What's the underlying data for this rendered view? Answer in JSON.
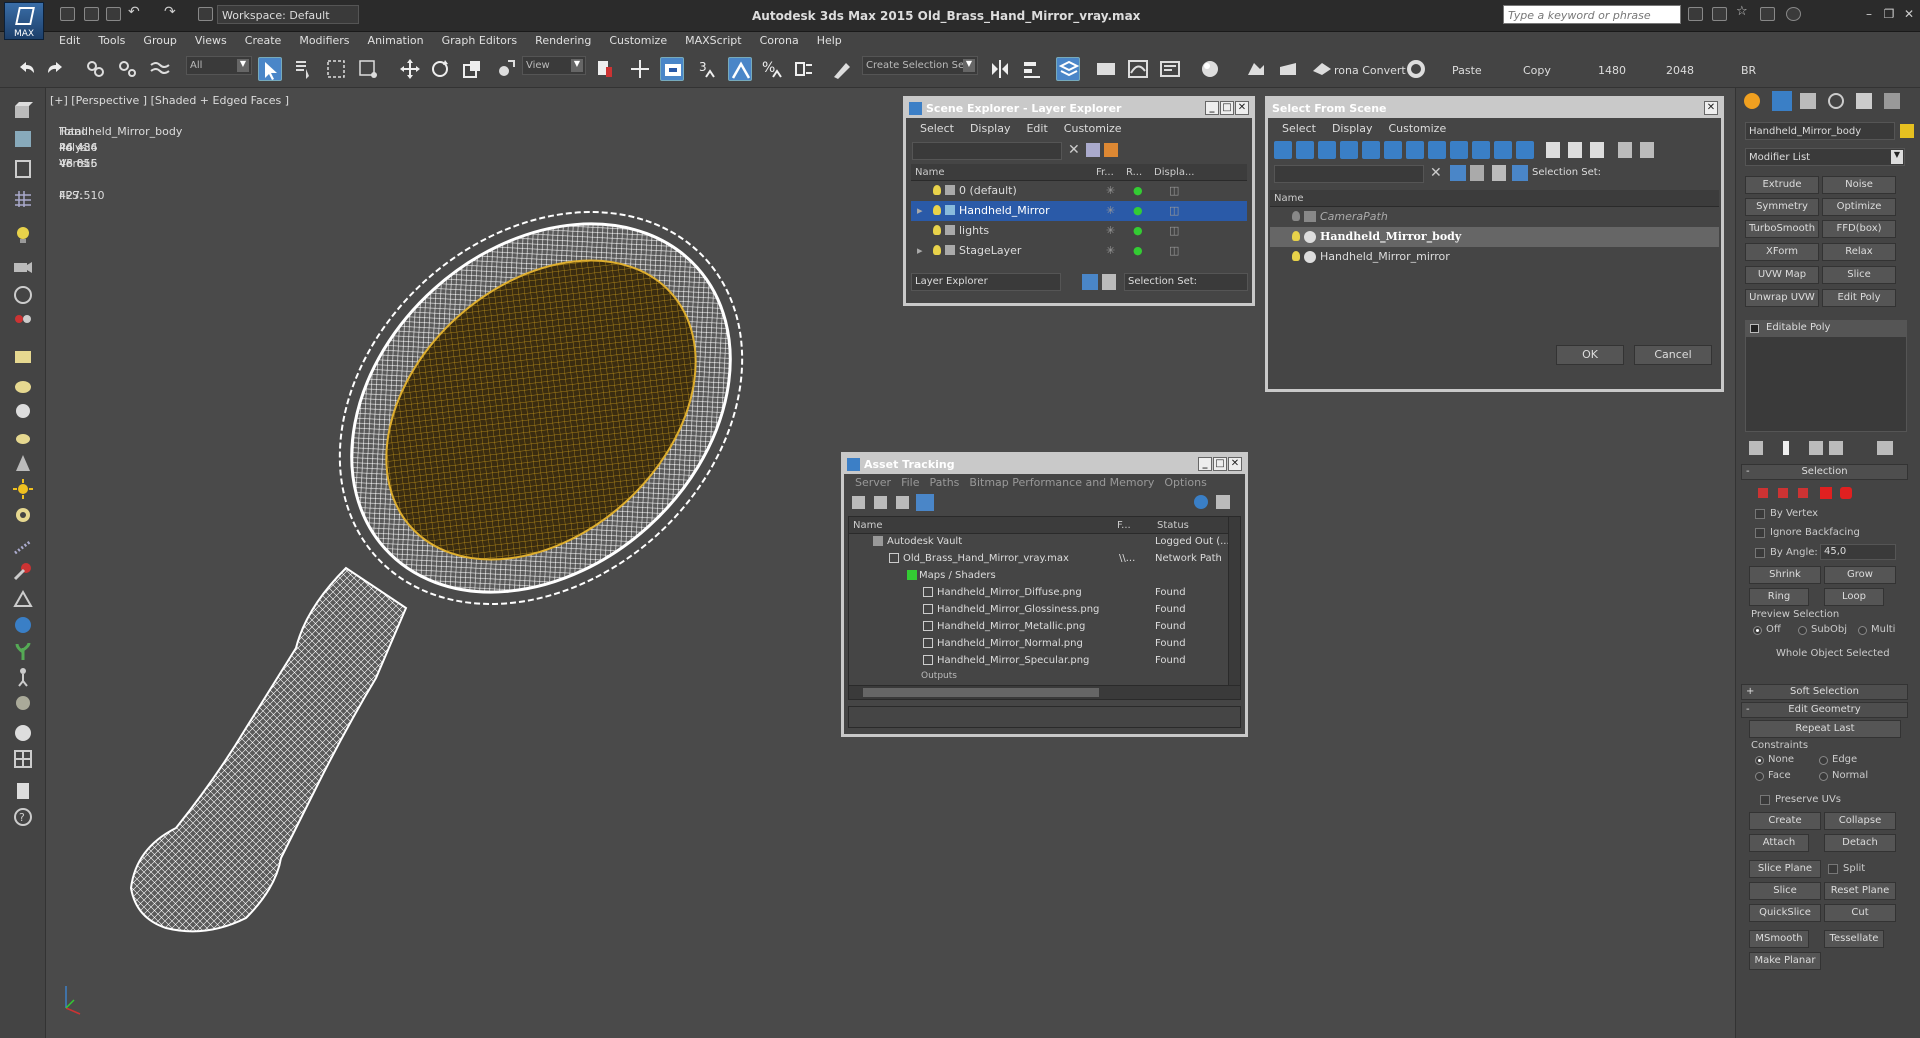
{
  "titlebar": {
    "logo_label": "MAX",
    "workspace": "Workspace: Default",
    "title": "Autodesk 3ds Max  2015    Old_Brass_Hand_Mirror_vray.max",
    "search_placeholder": "Type a keyword or phrase"
  },
  "menu": [
    "Edit",
    "Tools",
    "Group",
    "Views",
    "Create",
    "Modifiers",
    "Animation",
    "Graph Editors",
    "Rendering",
    "Customize",
    "MAXScript",
    "Corona",
    "Help"
  ],
  "toolbar": {
    "filter_all": "All",
    "ref_coord": "View",
    "selection_set": "Create Selection Se",
    "snap_num": "3",
    "corona_convert": "rona Convert",
    "paste": "Paste",
    "copy": "Copy",
    "w1": "1480",
    "w2": "2048",
    "br": "BR"
  },
  "viewport": {
    "label": "[+] [Perspective ] [Shaded + Edged Faces ]",
    "stats": {
      "total_label": "Total",
      "object_label": "Handheld_Mirror_body",
      "polys_label": "Polys:",
      "polys_total": "46 486",
      "polys_object": "44 434",
      "verts_label": "Verts:",
      "verts_total": "46 016",
      "verts_object": "43 855",
      "fps_label": "FPS:",
      "fps_value": "427.510"
    }
  },
  "scene_explorer": {
    "title": "Scene Explorer - Layer Explorer",
    "menu": [
      "Select",
      "Display",
      "Edit",
      "Customize"
    ],
    "columns": [
      "Name",
      "Fr...",
      "R...",
      "Displa..."
    ],
    "layers": [
      {
        "name": "0 (default)",
        "expand": ""
      },
      {
        "name": "Handheld_Mirror",
        "expand": "▸"
      },
      {
        "name": "lights",
        "expand": ""
      },
      {
        "name": "StageLayer",
        "expand": "▸"
      }
    ],
    "footer_mode": "Layer Explorer",
    "footer_selset": "Selection Set:"
  },
  "select_from_scene": {
    "title": "Select From Scene",
    "menu": [
      "Select",
      "Display",
      "Customize"
    ],
    "selection_set_label": "Selection Set:",
    "column_name": "Name",
    "items": [
      "CameraPath",
      "Handheld_Mirror_body",
      "Handheld_Mirror_mirror"
    ],
    "ok": "OK",
    "cancel": "Cancel"
  },
  "asset_tracking": {
    "title": "Asset Tracking",
    "menu": [
      "Server",
      "File",
      "Paths",
      "Bitmap Performance and Memory",
      "Options"
    ],
    "columns": [
      "Name",
      "F...",
      "Status"
    ],
    "rows": [
      {
        "name": "Autodesk Vault",
        "f": "",
        "status": "Logged Out (..."
      },
      {
        "name": "Old_Brass_Hand_Mirror_vray.max",
        "f": "\\\\...",
        "status": "Network Path"
      },
      {
        "name": "Maps / Shaders",
        "f": "",
        "status": ""
      },
      {
        "name": "Handheld_Mirror_Diffuse.png",
        "f": "",
        "status": "Found"
      },
      {
        "name": "Handheld_Mirror_Glossiness.png",
        "f": "",
        "status": "Found"
      },
      {
        "name": "Handheld_Mirror_Metallic.png",
        "f": "",
        "status": "Found"
      },
      {
        "name": "Handheld_Mirror_Normal.png",
        "f": "",
        "status": "Found"
      },
      {
        "name": "Handheld_Mirror_Specular.png",
        "f": "",
        "status": "Found"
      },
      {
        "name": "Outputs",
        "f": "",
        "status": ""
      }
    ]
  },
  "command_panel": {
    "object_name": "Handheld_Mirror_body",
    "modifier_list": "Modifier List",
    "modifier_buttons": [
      "Extrude",
      "Noise",
      "Symmetry",
      "Optimize",
      "TurboSmooth",
      "FFD(box)",
      "XForm",
      "Relax",
      "UVW Map",
      "Slice",
      "Unwrap UVW",
      "Edit Poly"
    ],
    "stack_item": "Editable Poly",
    "selection": {
      "title": "Selection",
      "by_vertex": "By Vertex",
      "ignore_backfacing": "Ignore Backfacing",
      "by_angle": "By Angle:",
      "angle_value": "45,0",
      "shrink": "Shrink",
      "grow": "Grow",
      "ring": "Ring",
      "loop": "Loop",
      "preview_selection": "Preview Selection",
      "off": "Off",
      "subobj": "SubObj",
      "multi": "Multi",
      "whole_object": "Whole Object Selected"
    },
    "soft_selection": "Soft Selection",
    "edit_geometry": {
      "title": "Edit Geometry",
      "repeat_last": "Repeat Last",
      "constraints": "Constraints",
      "none": "None",
      "edge": "Edge",
      "face": "Face",
      "normal": "Normal",
      "preserve_uvs": "Preserve UVs",
      "create": "Create",
      "collapse": "Collapse",
      "attach": "Attach",
      "detach": "Detach",
      "slice_plane": "Slice Plane",
      "split": "Split",
      "slice": "Slice",
      "reset_plane": "Reset Plane",
      "quickslice": "QuickSlice",
      "cut": "Cut",
      "msmooth": "MSmooth",
      "tessellate": "Tessellate",
      "make_planar": "Make Planar"
    }
  },
  "colors": {
    "selected_row": "#2a5aa8",
    "stats": "#e0c860",
    "mirror_fill": "#3a2c10",
    "mirror_wire": "#c99a1a",
    "wire": "#ffffff"
  }
}
